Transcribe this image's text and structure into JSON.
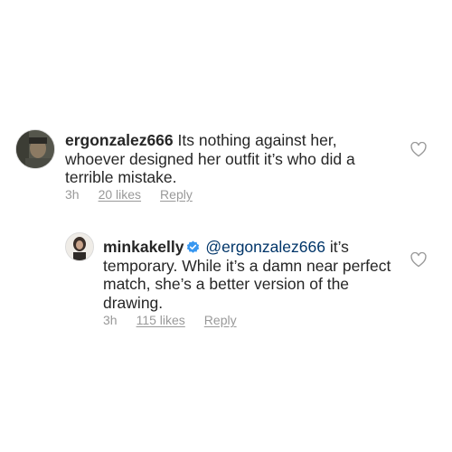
{
  "comments": [
    {
      "username": "ergonzalez666",
      "text": "Its nothing against her, whoever designed her outfit it’s who did a terrible mistake.",
      "time": "3h",
      "likes": "20 likes",
      "reply_label": "Reply"
    },
    {
      "username": "minkakelly",
      "verified": true,
      "mention": "@ergonzalez666",
      "text": "it’s temporary. While it’s a damn near perfect match, she’s a better version of the drawing.",
      "time": "3h",
      "likes": "115 likes",
      "reply_label": "Reply"
    }
  ],
  "icons": {
    "like": "heart-outline-icon",
    "verified": "verified-badge-icon"
  },
  "colors": {
    "verified_blue": "#3897f0",
    "meta_gray": "#999999",
    "mention": "#003569"
  }
}
